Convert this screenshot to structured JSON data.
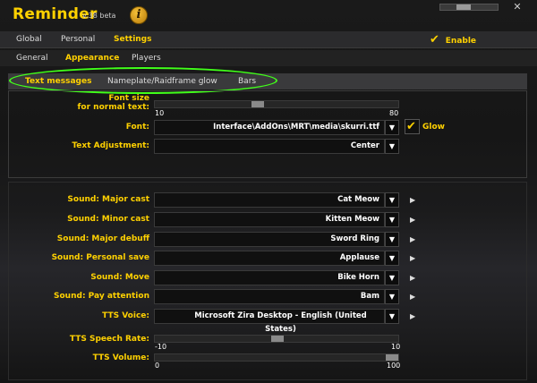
{
  "window": {
    "title": "Reminder",
    "version": "v.38 beta",
    "info_icon": "i",
    "close": "✕"
  },
  "tabs": [
    {
      "label": "Global"
    },
    {
      "label": "Personal"
    },
    {
      "label": "Settings"
    }
  ],
  "enable": {
    "label": "Enable",
    "checked": true
  },
  "subtabs": [
    {
      "label": "General"
    },
    {
      "label": "Appearance"
    },
    {
      "label": "Players"
    }
  ],
  "tabs3": [
    {
      "label": "Text messages"
    },
    {
      "label": "Nameplate/Raidframe glow"
    },
    {
      "label": "Bars"
    }
  ],
  "font_size": {
    "label": "Font size\nfor normal text:",
    "min": "10",
    "max": "80"
  },
  "font": {
    "label": "Font:",
    "value": "Interface\\AddOns\\MRT\\media\\skurri.ttf",
    "glow_label": "Glow",
    "glow_checked": true
  },
  "text_adj": {
    "label": "Text Adjustment:",
    "value": "Center"
  },
  "sounds": [
    {
      "label": "Sound: Major cast",
      "value": "Cat Meow"
    },
    {
      "label": "Sound: Minor cast",
      "value": "Kitten Meow"
    },
    {
      "label": "Sound: Major debuff",
      "value": "Sword Ring"
    },
    {
      "label": "Sound: Personal save",
      "value": "Applause"
    },
    {
      "label": "Sound: Move",
      "value": "Bike Horn"
    },
    {
      "label": "Sound: Pay attention",
      "value": "Bam"
    },
    {
      "label": "TTS Voice:",
      "value": "Microsoft Zira Desktop - English (United States)"
    }
  ],
  "tts_rate": {
    "label": "TTS Speech Rate:",
    "min": "-10",
    "max": "10"
  },
  "tts_volume": {
    "label": "TTS Volume:",
    "min": "0",
    "max": "100"
  },
  "colors": {
    "accent": "#ffd100",
    "highlight": "#41ff1a"
  }
}
